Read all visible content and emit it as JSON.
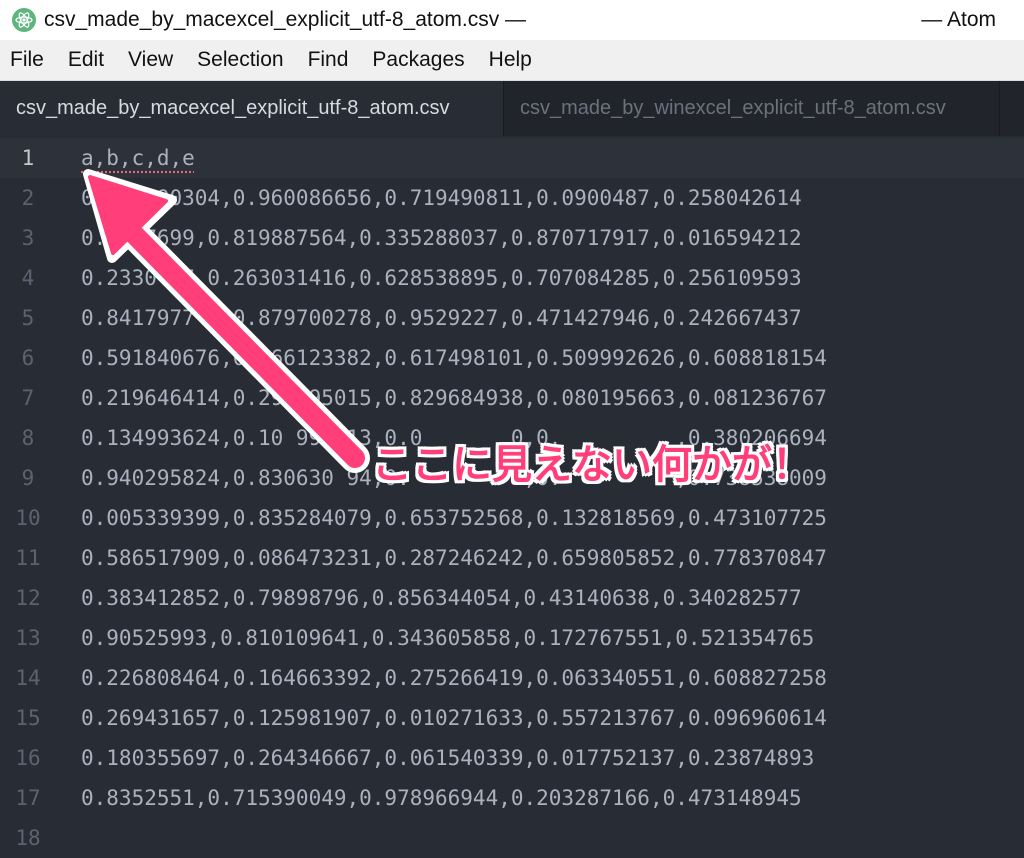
{
  "window": {
    "title": "csv_made_by_macexcel_explicit_utf-8_atom.csv —",
    "app_name": "— Atom"
  },
  "menu": [
    "File",
    "Edit",
    "View",
    "Selection",
    "Find",
    "Packages",
    "Help"
  ],
  "tabs": [
    {
      "label": "csv_made_by_macexcel_explicit_utf-8_atom.csv",
      "active": true
    },
    {
      "label": "csv_made_by_winexcel_explicit_utf-8_atom.csv",
      "active": false
    }
  ],
  "editor": {
    "lines": [
      {
        "num": "1",
        "text": "a,b,c,d,e"
      },
      {
        "num": "2",
        "text": "0.351390304,0.960086656,0.719490811,0.0900487,0.258042614"
      },
      {
        "num": "3",
        "text": "0.8 97699,0.819887564,0.335288037,0.870717917,0.016594212"
      },
      {
        "num": "4",
        "text": "0.2330 37,0.263031416,0.628538895,0.707084285,0.256109593"
      },
      {
        "num": "5",
        "text": "0.8417977 1,0.879700278,0.9529227,0.471427946,0.242667437"
      },
      {
        "num": "6",
        "text": "0.591840676,0.966123382,0.617498101,0.509992626,0.608818154"
      },
      {
        "num": "7",
        "text": "0.219646414,0.293095015,0.829684938,0.080195663,0.081236767"
      },
      {
        "num": "8",
        "text": "0.134993624,0.10 993013,0.0       0,0.         ,0.380206694"
      },
      {
        "num": "9",
        "text": "0.940295824,0.830630 94,0.         ,0.         ,0.738538009"
      },
      {
        "num": "10",
        "text": "0.005339399,0.835284079,0.653752568,0.132818569,0.473107725"
      },
      {
        "num": "11",
        "text": "0.586517909,0.086473231,0.287246242,0.659805852,0.778370847"
      },
      {
        "num": "12",
        "text": "0.383412852,0.79898796,0.856344054,0.43140638,0.340282577"
      },
      {
        "num": "13",
        "text": "0.90525993,0.810109641,0.343605858,0.172767551,0.521354765"
      },
      {
        "num": "14",
        "text": "0.226808464,0.164663392,0.275266419,0.063340551,0.608827258"
      },
      {
        "num": "15",
        "text": "0.269431657,0.125981907,0.010271633,0.557213767,0.096960614"
      },
      {
        "num": "16",
        "text": "0.180355697,0.264346667,0.061540339,0.017752137,0.23874893"
      },
      {
        "num": "17",
        "text": "0.8352551,0.715390049,0.978966944,0.203287166,0.473148945"
      },
      {
        "num": "18",
        "text": ""
      }
    ]
  },
  "annotation": {
    "text": "ここに見えない何かが！",
    "color": "#ff3e7a"
  }
}
